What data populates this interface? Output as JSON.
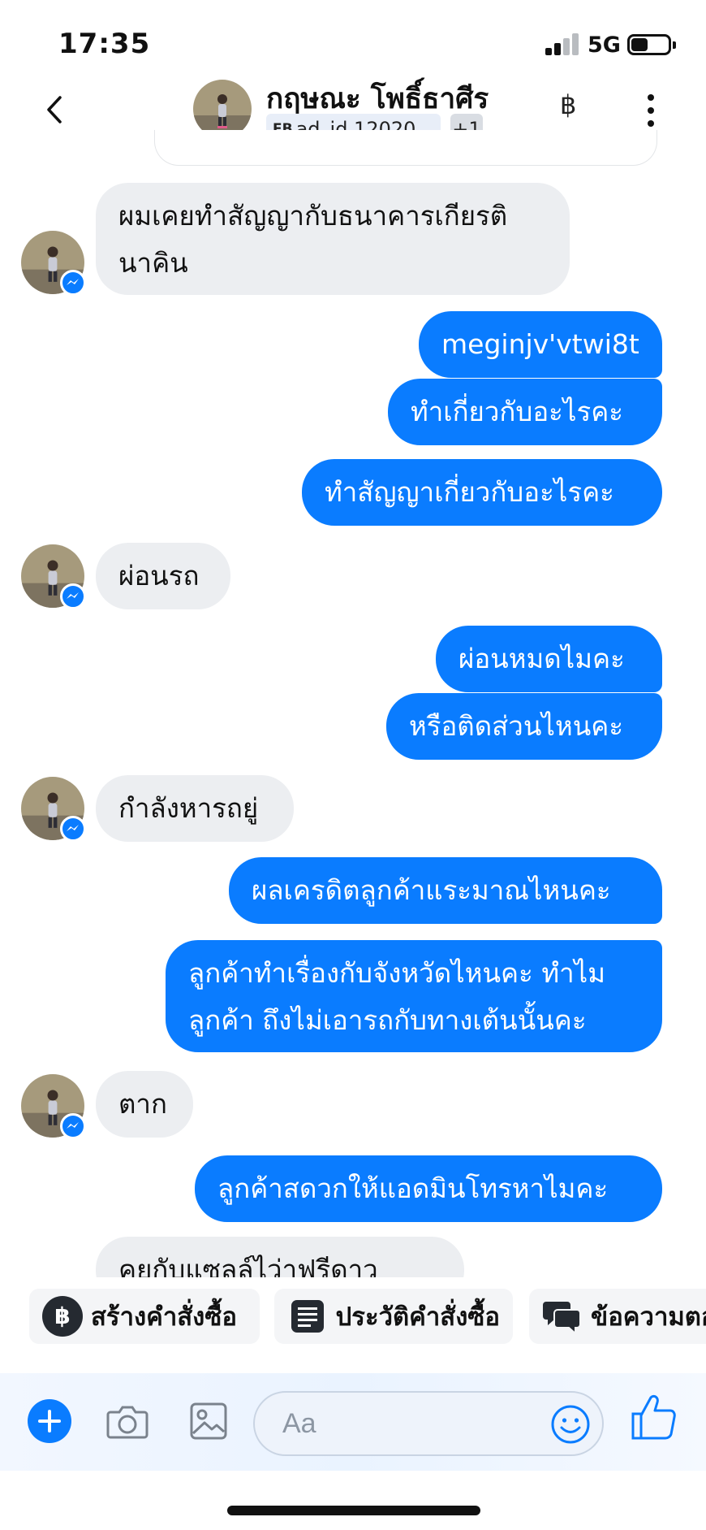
{
  "status_bar": {
    "time": "17:35",
    "network": "5G"
  },
  "header": {
    "contact_name": "กฤษณะ โพธิ์ธาศีร",
    "tag_prefix": "FB",
    "tag_text": "ad_id.12020...",
    "tag_extra": "+1",
    "currency_symbol": "฿"
  },
  "messages": [
    {
      "dir": "in",
      "lines": [
        "ผมเคยทำสัญญากับธนาคารเกียรติ",
        "นาคิน"
      ]
    },
    {
      "dir": "out",
      "lines": [
        "meginjv'vtwi8t"
      ]
    },
    {
      "dir": "out",
      "lines": [
        "ทำเกี่ยวกับอะไรคะ"
      ]
    },
    {
      "dir": "out",
      "lines": [
        "ทำสัญญาเกี่ยวกับอะไรคะ"
      ]
    },
    {
      "dir": "in",
      "lines": [
        "ผ่อนรถ"
      ]
    },
    {
      "dir": "out",
      "lines": [
        "ผ่อนหมดไมคะ"
      ]
    },
    {
      "dir": "out",
      "lines": [
        "หรือติดส่วนไหนคะ"
      ]
    },
    {
      "dir": "in",
      "lines": [
        "กำลังหารถยู่"
      ]
    },
    {
      "dir": "out",
      "lines": [
        "ผลเครดิตลูกค้าแระมาณไหนคะ"
      ]
    },
    {
      "dir": "out",
      "lines": [
        "ลูกค้าทำเรื่องกับจังหวัดไหนคะ ทำไม",
        "ลูกค้า ถึงไม่เอารถกับทางเต้นนั้นคะ"
      ]
    },
    {
      "dir": "in",
      "lines": [
        "ตาก"
      ]
    },
    {
      "dir": "out",
      "lines": [
        "ลูกค้าสดวกให้แอดมินโทรหาไมคะ"
      ]
    },
    {
      "dir": "in",
      "lines": [
        "คุยกับแซลล์ไว่าฟรีดาว"
      ]
    }
  ],
  "quick_actions": [
    {
      "label": "สร้างคำสั่งซื้อ",
      "icon": "baht-circle-icon"
    },
    {
      "label": "ประวัติคำสั่งซื้อ",
      "icon": "order-list-icon"
    },
    {
      "label": "ข้อความตอ",
      "icon": "chat-bubbles-icon"
    }
  ],
  "composer": {
    "placeholder": "Aa"
  },
  "colors": {
    "outgoing": "#0a7cff",
    "incoming": "#eceef1",
    "accent": "#0a7cff"
  }
}
